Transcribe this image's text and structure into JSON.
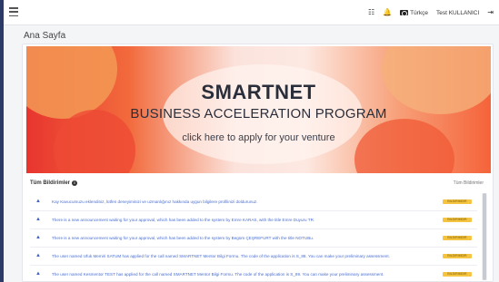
{
  "topbar": {
    "menu_icon": "hamburger-icon",
    "icons": [
      "list-icon",
      "bell-icon"
    ],
    "language": "Türkçe",
    "user": "Test KULLANICI",
    "logout_icon": "logout-icon"
  },
  "page": {
    "title": "Ana Sayfa"
  },
  "banner": {
    "line1": "SMARTNET",
    "line2": "BUSINESS ACCELERATION PROGRAM",
    "line3": "click here to apply for your venture"
  },
  "notifications": {
    "title": "Tüm Bildirimler",
    "all_link": "Tüm Bildirimler",
    "items": [
      {
        "text": "Kay Kavucumuzu eklendiniz, lütfen deneyiminizi ve uzmanlığınız hakkında uygun bilgilere profilinizi doldurunuz.",
        "badge": "BILDIRIMDIR"
      },
      {
        "text": "There is a new announcement waiting for your approval, which has been added to the system by Emre KARAS, with the title Emre Duyuru TR.",
        "badge": "BILDIRIMDIR"
      },
      {
        "text": "There is a new announcement waiting for your approval, which has been added to the system by Begüm ÇEŞREFURT with the title NOTUBu.",
        "badge": "BILDIRIMDIR"
      },
      {
        "text": "The user named Ufuk Memiri SATUM has applied for the call named SMARTNET Mentor Bilgi Formu. The code of the application is S_88. You can make your preliminary assessment.",
        "badge": "BILDIRIMDIR"
      },
      {
        "text": "The user named Kesmentor TEST has applied for the call named SMARTNET Mentor Bilgi Formu. The code of the application is S_89. You can make your preliminary assessment.",
        "badge": "BILDIRIMDIR"
      }
    ]
  }
}
